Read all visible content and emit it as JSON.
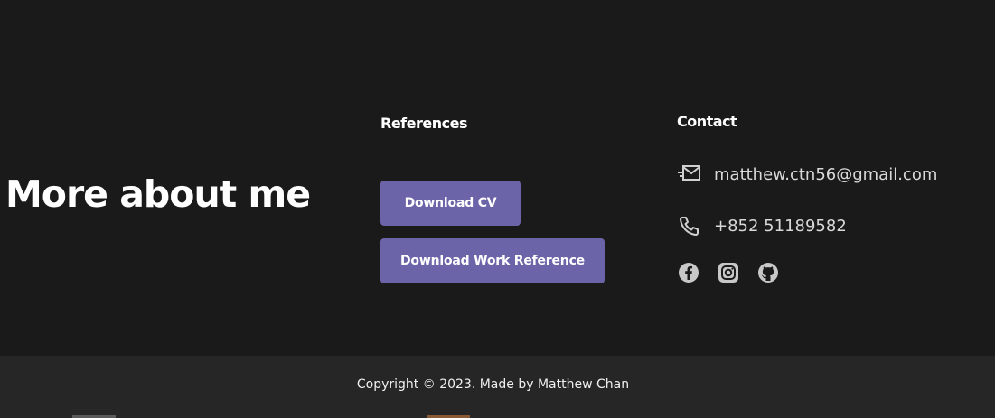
{
  "about": {
    "title": "More about me",
    "references": {
      "heading": "References",
      "download_cv_label": "Download CV",
      "download_work_label": "Download Work Reference"
    },
    "contact": {
      "heading": "Contact",
      "email": "matthew.ctn56@gmail.com",
      "email_icon": "mail-icon",
      "phone": "+852 51189582",
      "phone_icon": "phone-icon",
      "social": [
        "facebook-icon",
        "instagram-icon",
        "github-icon"
      ]
    }
  },
  "footer": {
    "copyright": "Copyright © 2023. Made by Matthew Chan"
  },
  "colors": {
    "background": "#1a1a1a",
    "footer_background": "#262626",
    "button": "#6c64a8",
    "icon": "#c8c8c8"
  }
}
